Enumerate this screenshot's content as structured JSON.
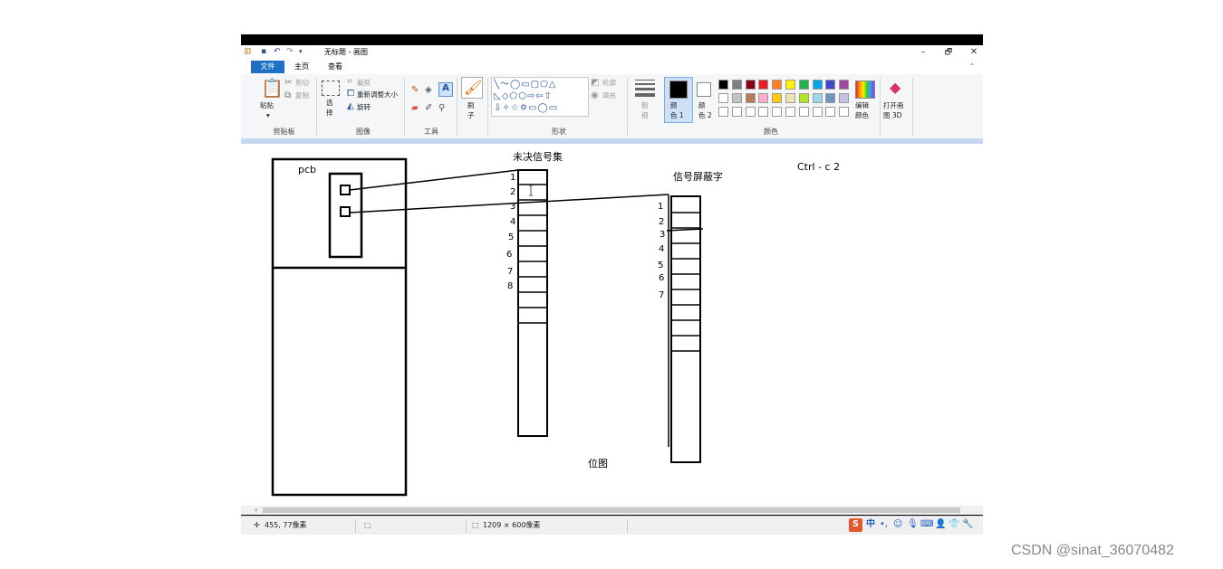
{
  "window": {
    "title": "无标题 - 画图",
    "controls": {
      "minimize": "–",
      "maximize": "🗗",
      "close": "✕"
    }
  },
  "tabs": {
    "file": "文件",
    "home": "主页",
    "view": "查看"
  },
  "ribbon": {
    "clipboard": {
      "label": "剪贴板",
      "paste": "粘贴",
      "cut": "剪切",
      "copy": "复制"
    },
    "image": {
      "label": "图像",
      "select": "选\n择",
      "crop": "裁剪",
      "resize": "重新调整大小",
      "rotate": "旋转"
    },
    "tools": {
      "label": "工具",
      "text_tool": "A"
    },
    "brush": {
      "label": "刷\n子"
    },
    "shapes": {
      "label": "形状",
      "glyphs_row1": "╲〜◯▭▢⬠△",
      "glyphs_row2": "◺◇⬠⬡⇨⇦⇧",
      "glyphs_row3": "⇩✧☆✡▭◯▭",
      "outline": "轮廓",
      "fill": "填充"
    },
    "size": {
      "label": "粗\n细"
    },
    "color1": {
      "label": "颜\n色 1",
      "value": "#000000"
    },
    "color2": {
      "label": "颜\n色 2",
      "value": "#ffffff"
    },
    "colors": {
      "label": "颜色",
      "edit": "编辑\n颜色"
    },
    "paint3d": {
      "label": "打开画\n图 3D"
    },
    "palette_row1": [
      "#000000",
      "#7f7f7f",
      "#880015",
      "#ed1c24",
      "#ff7f27",
      "#fff200",
      "#22b14c",
      "#00a2e8",
      "#3f48cc",
      "#a349a4"
    ],
    "palette_row2": [
      "#ffffff",
      "#c3c3c3",
      "#b97a57",
      "#ffaec9",
      "#ffc90e",
      "#efe4b0",
      "#b5e61d",
      "#99d9ea",
      "#7092be",
      "#c8bfe7"
    ]
  },
  "canvas": {
    "pcb_label": "pcb",
    "pending_title": "未决信号集",
    "mask_title": "信号屏蔽字",
    "ctrl_note": "Ctrl - c  2",
    "bitmap_label": "位图",
    "pending_numbers": [
      "1",
      "2",
      "3",
      "4",
      "5",
      "6",
      "7",
      "8"
    ],
    "mask_numbers": [
      "1",
      "2",
      "3",
      "4",
      "5",
      "6",
      "7"
    ]
  },
  "statusbar": {
    "cursor_pos": "455, 77像素",
    "image_size": "1209 × 600像素"
  },
  "watermark": "CSDN @sinat_36070482"
}
